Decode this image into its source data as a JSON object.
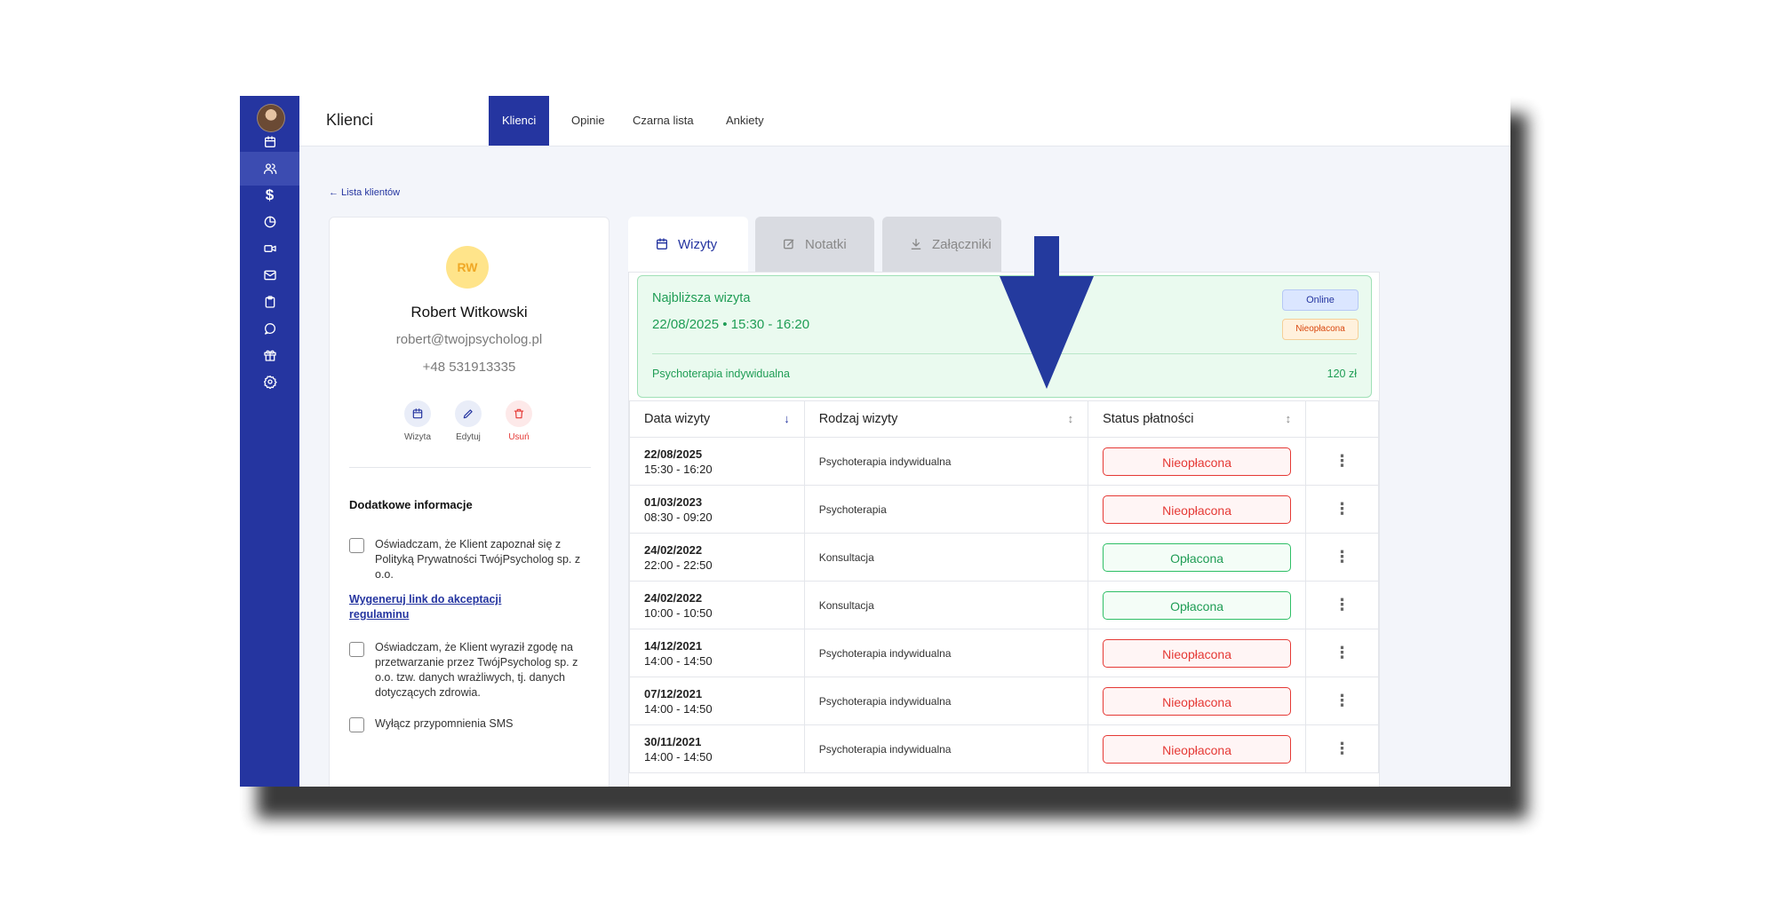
{
  "header": {
    "title": "Klienci",
    "tabs": [
      {
        "label": "Klienci",
        "active": true
      },
      {
        "label": "Opinie",
        "active": false
      },
      {
        "label": "Czarna lista",
        "active": false
      },
      {
        "label": "Ankiety",
        "active": false
      }
    ]
  },
  "sidebar": {
    "icons": [
      "calendar-icon",
      "users-icon",
      "dollar-icon",
      "pie-chart-icon",
      "video-icon",
      "mail-icon",
      "clipboard-icon",
      "chat-icon",
      "gift-icon",
      "settings-icon"
    ],
    "active_index": 1
  },
  "back_link": "← Lista klientów",
  "client": {
    "initials": "RW",
    "name": "Robert Witkowski",
    "email": "robert@twojpsycholog.pl",
    "phone": "+48 531913335",
    "actions": {
      "visit": "Wizyta",
      "edit": "Edytuj",
      "delete": "Usuń"
    },
    "additional_info_title": "Dodatkowe informacje",
    "privacy_consent": "Oświadczam, że Klient zapoznał się z Polityką Prywatności TwójPsycholog sp. z o.o.",
    "generate_link": "Wygeneruj link do akceptacji regulaminu",
    "data_consent": "Oświadczam, że Klient wyraził zgodę na przetwarzanie przez TwójPsycholog sp. z o.o. tzw. danych wrażliwych, tj. danych dotyczących zdrowia.",
    "sms_opt_out": "Wyłącz przypomnienia SMS"
  },
  "panel_tabs": {
    "visits": "Wizyty",
    "notes": "Notatki",
    "attachments": "Załączniki"
  },
  "next_visit": {
    "title": "Najbliższa wizyta",
    "datetime": "22/08/2025  •  15:30 - 16:20",
    "mode": "Online",
    "payment": "Nieopłacona",
    "type": "Psychoterapia indywidualna",
    "price": "120 zł"
  },
  "table": {
    "columns": {
      "date": "Data wizyty",
      "type": "Rodzaj wizyty",
      "status": "Status płatności"
    },
    "rows": [
      {
        "date": "22/08/2025",
        "time": "15:30 - 16:20",
        "type": "Psychoterapia indywidualna",
        "status": "Nieopłacona",
        "paid": false
      },
      {
        "date": "01/03/2023",
        "time": "08:30 - 09:20",
        "type": "Psychoterapia",
        "status": "Nieopłacona",
        "paid": false
      },
      {
        "date": "24/02/2022",
        "time": "22:00 - 22:50",
        "type": "Konsultacja",
        "status": "Opłacona",
        "paid": true
      },
      {
        "date": "24/02/2022",
        "time": "10:00 - 10:50",
        "type": "Konsultacja",
        "status": "Opłacona",
        "paid": true
      },
      {
        "date": "14/12/2021",
        "time": "14:00 - 14:50",
        "type": "Psychoterapia indywidualna",
        "status": "Nieopłacona",
        "paid": false
      },
      {
        "date": "07/12/2021",
        "time": "14:00 - 14:50",
        "type": "Psychoterapia indywidualna",
        "status": "Nieopłacona",
        "paid": false
      },
      {
        "date": "30/11/2021",
        "time": "14:00 - 14:50",
        "type": "Psychoterapia indywidualna",
        "status": "Nieopłacona",
        "paid": false
      }
    ]
  },
  "colors": {
    "primary": "#2535a0",
    "success": "#1f9d55",
    "danger": "#e53935",
    "arrow": "#243a9e"
  }
}
